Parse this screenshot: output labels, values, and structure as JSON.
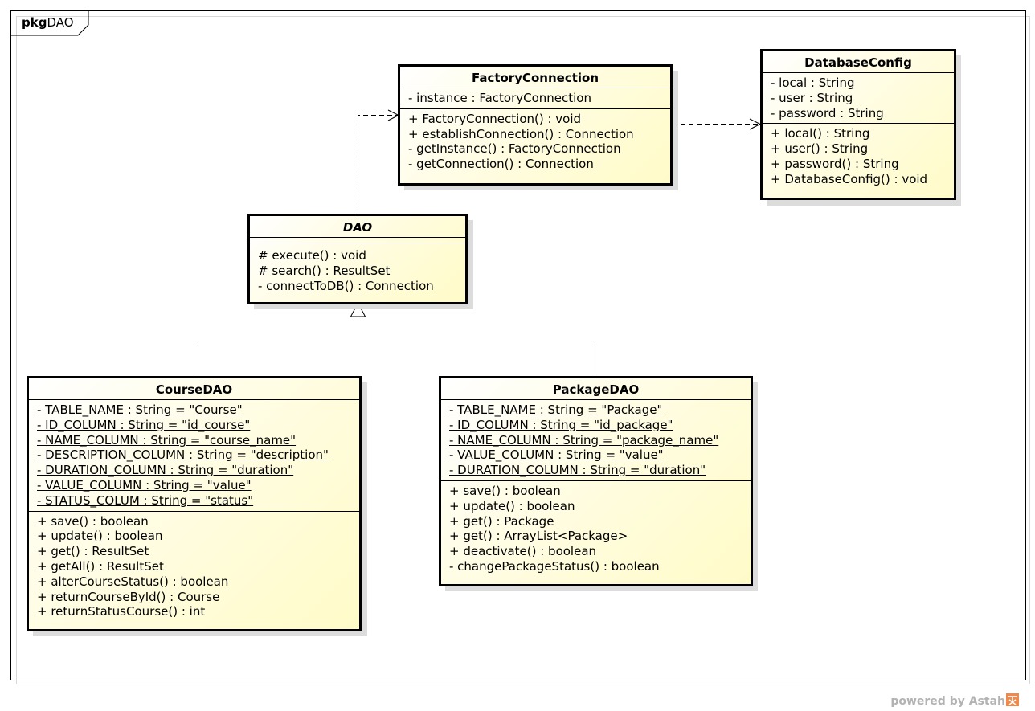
{
  "package": {
    "keyword": "pkg",
    "name": "DAO"
  },
  "classes": {
    "factory": {
      "name": "FactoryConnection",
      "attributes": [
        "- instance : FactoryConnection"
      ],
      "operations": [
        "+ FactoryConnection() : void",
        "+ establishConnection() : Connection",
        "- getInstance() : FactoryConnection",
        "- getConnection() : Connection"
      ]
    },
    "dbconfig": {
      "name": "DatabaseConfig",
      "attributes": [
        "- local : String",
        "- user : String",
        "- password : String"
      ],
      "operations": [
        "+ local() : String",
        "+ user() : String",
        "+ password() : String",
        "+ DatabaseConfig() : void"
      ]
    },
    "dao": {
      "name": "DAO",
      "abstract": true,
      "attributes": [],
      "operations": [
        "# execute() : void",
        "# search() : ResultSet",
        "- connectToDB() : Connection"
      ]
    },
    "course": {
      "name": "CourseDAO",
      "attributes": [
        "- TABLE_NAME : String = \"Course\"",
        "- ID_COLUMN : String = \"id_course\"",
        "- NAME_COLUMN : String = \"course_name\"",
        "- DESCRIPTION_COLUMN : String = \"description\"",
        "- DURATION_COLUMN : String = \"duration\"",
        "- VALUE_COLUMN : String = \"value\"",
        "- STATUS_COLUM : String = \"status\""
      ],
      "operations": [
        "+ save() : boolean",
        "+ update() : boolean",
        "+ get() : ResultSet",
        "+ getAll() : ResultSet",
        "+ alterCourseStatus() : boolean",
        "+ returnCourseById() : Course",
        "+ returnStatusCourse() : int"
      ]
    },
    "package": {
      "name": "PackageDAO",
      "attributes": [
        "- TABLE_NAME : String = \"Package\"",
        "- ID_COLUMN : String = \"id_package\"",
        "- NAME_COLUMN : String = \"package_name\"",
        "- VALUE_COLUMN : String = \"value\"",
        "- DURATION_COLUMN : String = \"duration\""
      ],
      "operations": [
        "+ save() : boolean",
        "+ update() : boolean",
        "+ get() : Package",
        "+ get() : ArrayList<Package>",
        "+ deactivate() : boolean",
        "- changePackageStatus() : boolean"
      ]
    }
  },
  "relations": [
    {
      "type": "dependency",
      "from": "DAO",
      "to": "FactoryConnection"
    },
    {
      "type": "dependency",
      "from": "FactoryConnection",
      "to": "DatabaseConfig"
    },
    {
      "type": "generalization",
      "from": "CourseDAO",
      "to": "DAO"
    },
    {
      "type": "generalization",
      "from": "PackageDAO",
      "to": "DAO"
    }
  ],
  "footer": {
    "powered_by": "powered by Astah",
    "logo_icon": "astah-logo-icon"
  }
}
